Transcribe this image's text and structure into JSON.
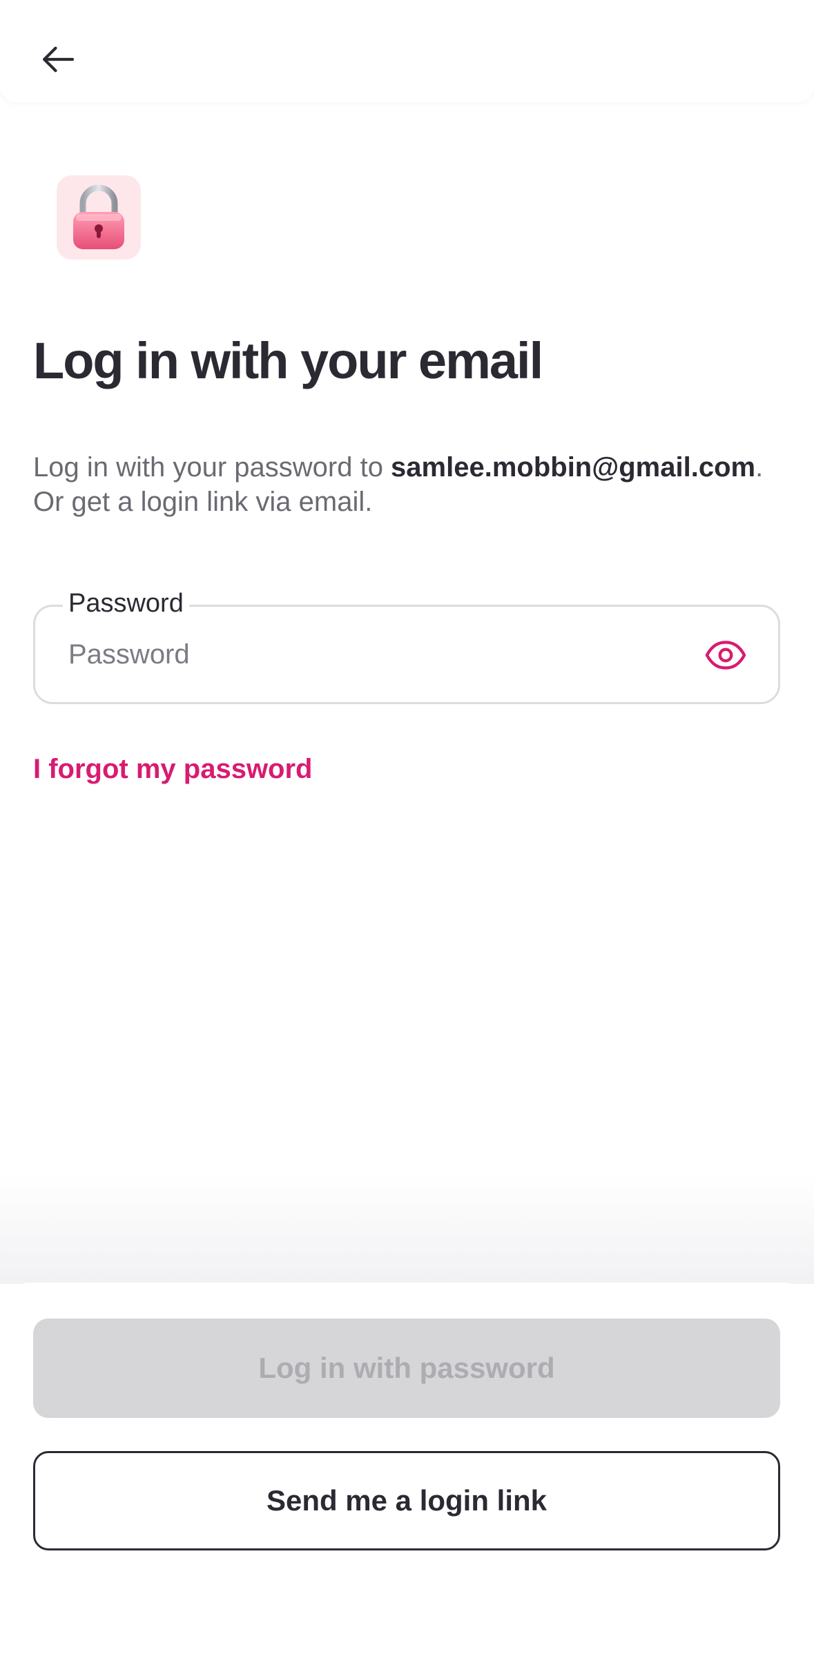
{
  "header": {
    "back_icon": "arrow-left-icon"
  },
  "hero": {
    "icon": "lock-icon",
    "title": "Log in with your email"
  },
  "description": {
    "prefix": "Log in with your password to ",
    "email": "samlee.mobbin@gmail.com",
    "suffix": ". Or get a login link via email."
  },
  "password_field": {
    "label": "Password",
    "placeholder": "Password",
    "value": "",
    "toggle_icon": "eye-icon"
  },
  "links": {
    "forgot_password": "I forgot my password"
  },
  "actions": {
    "primary_label": "Log in with password",
    "primary_disabled": true,
    "secondary_label": "Send me a login link"
  },
  "colors": {
    "accent": "#d81b71",
    "text": "#2b2a33",
    "disabled_bg": "#d6d6d9",
    "disabled_text": "#acacb1"
  }
}
